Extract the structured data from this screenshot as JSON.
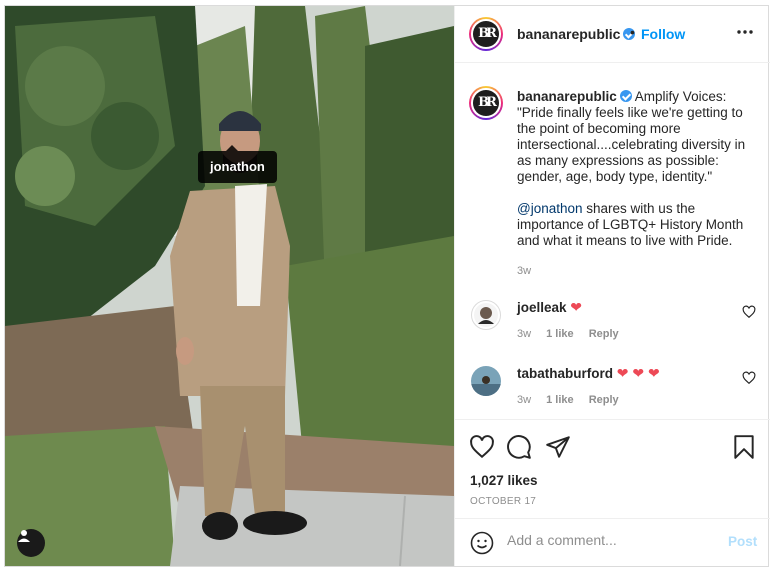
{
  "photo": {
    "tag_label": "jonathon",
    "user_tag_icon": "person-icon"
  },
  "header": {
    "username": "bananarepublic",
    "avatar_text": "BR",
    "separator": "•",
    "follow_label": "Follow",
    "more_icon": "more-options-icon"
  },
  "caption": {
    "username": "bananarepublic",
    "text_1": "Amplify Voices: \"Pride finally feels like we're getting to the point of becoming more intersectional....celebrating diversity in as many expressions as possible: gender, age, body type, identity.\"",
    "mention": "@jonathon",
    "text_2": "shares with us the importance of LGBTQ+ History Month and what it means to live with Pride.",
    "time": "3w"
  },
  "comments": [
    {
      "username": "joelleak",
      "hearts": "❤",
      "time": "3w",
      "likes": "1 like",
      "reply": "Reply"
    },
    {
      "username": "tabathaburford",
      "hearts": "❤ ❤ ❤",
      "time": "3w",
      "likes": "1 like",
      "reply": "Reply"
    }
  ],
  "actions": {
    "likes": "1,027 likes",
    "date": "OCTOBER 17"
  },
  "add_comment": {
    "placeholder": "Add a comment...",
    "post_label": "Post"
  },
  "colors": {
    "accent": "#0095f6",
    "verified": "#3897f0",
    "heart": "#ed4956",
    "post_disabled": "#b2dffc"
  }
}
